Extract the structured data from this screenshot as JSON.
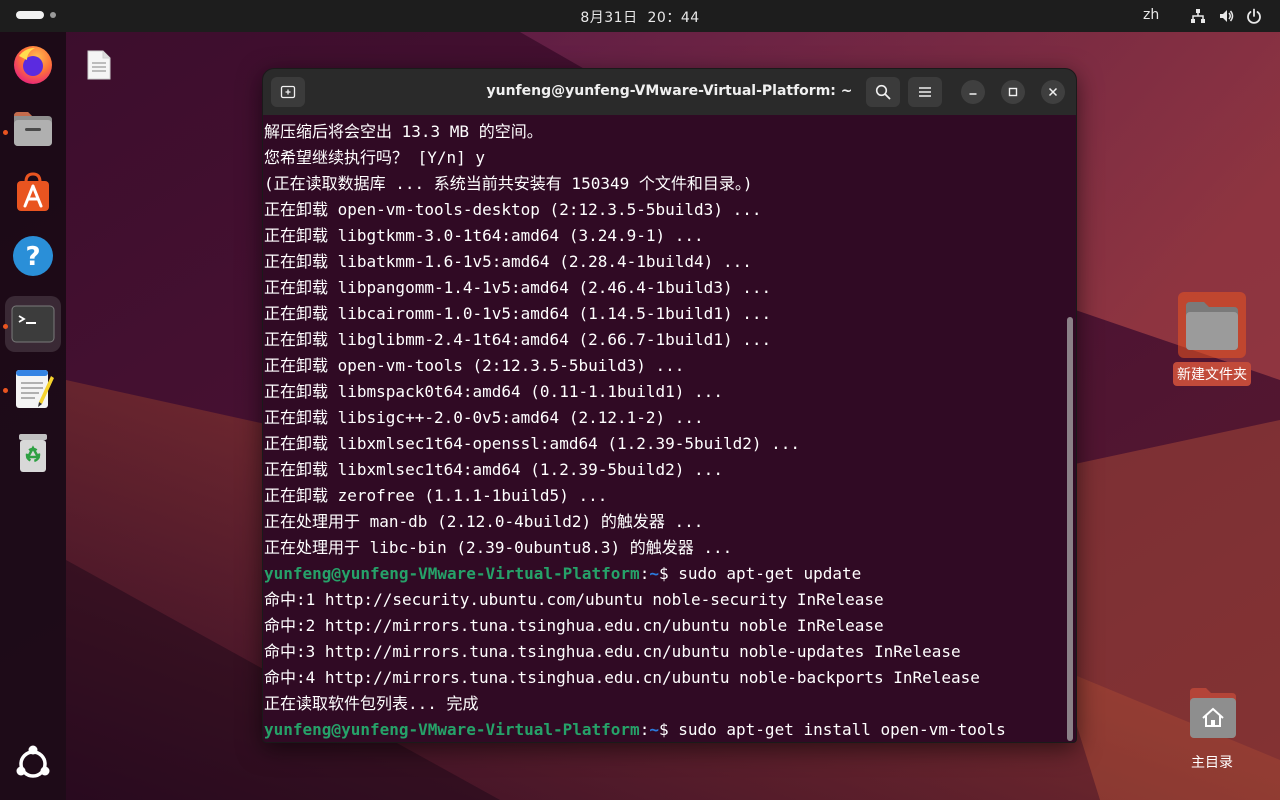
{
  "topbar": {
    "date": "8月31日",
    "time": "20：44",
    "lang": "zh"
  },
  "icons": {
    "activities": "activities-indicator",
    "network": "network-wired-icon",
    "volume": "volume-icon",
    "power": "power-icon"
  },
  "dock": {
    "items": [
      "firefox",
      "files",
      "app-center",
      "help",
      "terminal",
      "text-editor",
      "trash",
      "show-apps"
    ]
  },
  "desktop": {
    "new_folder_label": "新建文件夹",
    "home_label": "主目录"
  },
  "window": {
    "title": "yunfeng@yunfeng-VMware-Virtual-Platform: ~"
  },
  "terminal": {
    "lines": [
      "解压缩后将会空出 13.3 MB 的空间。",
      "您希望继续执行吗？ [Y/n] y",
      "(正在读取数据库 ... 系统当前共安装有 150349 个文件和目录。)",
      "正在卸载 open-vm-tools-desktop (2:12.3.5-5build3) ...",
      "正在卸载 libgtkmm-3.0-1t64:amd64 (3.24.9-1) ...",
      "正在卸载 libatkmm-1.6-1v5:amd64 (2.28.4-1build4) ...",
      "正在卸载 libpangomm-1.4-1v5:amd64 (2.46.4-1build3) ...",
      "正在卸载 libcairomm-1.0-1v5:amd64 (1.14.5-1build1) ...",
      "正在卸载 libglibmm-2.4-1t64:amd64 (2.66.7-1build1) ...",
      "正在卸载 open-vm-tools (2:12.3.5-5build3) ...",
      "正在卸载 libmspack0t64:amd64 (0.11-1.1build1) ...",
      "正在卸载 libsigc++-2.0-0v5:amd64 (2.12.1-2) ...",
      "正在卸载 libxmlsec1t64-openssl:amd64 (1.2.39-5build2) ...",
      "正在卸载 libxmlsec1t64:amd64 (1.2.39-5build2) ...",
      "正在卸载 zerofree (1.1.1-1build5) ...",
      "正在处理用于 man-db (2.12.0-4build2) 的触发器 ...",
      "正在处理用于 libc-bin (2.39-0ubuntu8.3) 的触发器 ...",
      {
        "user": "yunfeng@yunfeng-VMware-Virtual-Platform",
        "path": "~",
        "cmd": "$ sudo apt-get update"
      },
      "命中:1 http://security.ubuntu.com/ubuntu noble-security InRelease",
      "命中:2 http://mirrors.tuna.tsinghua.edu.cn/ubuntu noble InRelease",
      "命中:3 http://mirrors.tuna.tsinghua.edu.cn/ubuntu noble-updates InRelease",
      "命中:4 http://mirrors.tuna.tsinghua.edu.cn/ubuntu noble-backports InRelease",
      "正在读取软件包列表... 完成",
      {
        "user": "yunfeng@yunfeng-VMware-Virtual-Platform",
        "path": "~",
        "cmd": "$ sudo apt-get install open-vm-tools"
      }
    ]
  },
  "colors": {
    "terminal_bg": "#300a24",
    "prompt_user": "#26a269",
    "prompt_path": "#2a7bde",
    "accent": "#e95420"
  }
}
